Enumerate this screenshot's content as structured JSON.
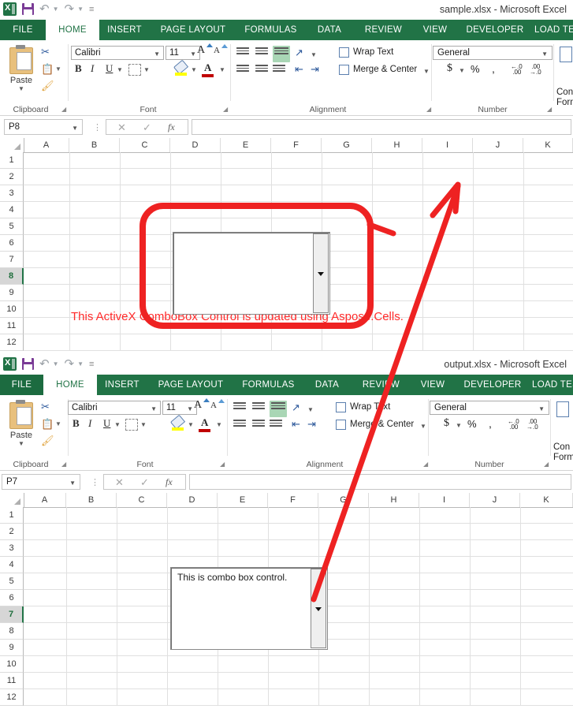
{
  "windows": [
    {
      "id": "sample",
      "title": "sample.xlsx - Microsoft Excel",
      "qat": {
        "logo": "excel-logo",
        "save": "save-icon",
        "undo": "undo-icon",
        "redo": "redo-icon",
        "more": "customize-qat-icon"
      },
      "tabs": [
        {
          "label": "FILE",
          "state": "file"
        },
        {
          "label": "HOME",
          "state": "active"
        },
        {
          "label": "INSERT",
          "state": "normal"
        },
        {
          "label": "PAGE LAYOUT",
          "state": "normal"
        },
        {
          "label": "FORMULAS",
          "state": "normal"
        },
        {
          "label": "DATA",
          "state": "normal"
        },
        {
          "label": "REVIEW",
          "state": "normal"
        },
        {
          "label": "VIEW",
          "state": "normal"
        },
        {
          "label": "DEVELOPER",
          "state": "normal"
        },
        {
          "label": "LOAD TE",
          "state": "normal"
        }
      ],
      "ribbon": {
        "groups": [
          "Clipboard",
          "Font",
          "Alignment",
          "Number"
        ],
        "paste_label": "Paste",
        "font_name": "Calibri",
        "font_size": "11",
        "wrap_text": "Wrap Text",
        "merge_center": "Merge & Center",
        "number_format": "General",
        "conditional_formatting": "Con\nForm"
      },
      "formula_bar": {
        "name_box": "P8",
        "formula": ""
      },
      "grid": {
        "columns": [
          "A",
          "B",
          "C",
          "D",
          "E",
          "F",
          "G",
          "H",
          "I",
          "J",
          "K"
        ],
        "rows": [
          "1",
          "2",
          "3",
          "4",
          "5",
          "6",
          "7",
          "8",
          "9",
          "10",
          "11",
          "12"
        ],
        "selected_row": "8",
        "note_text": "This ActiveX ComboBox Control is updated using Aspose.Cells.",
        "note_color": "#ff2a2a",
        "combobox_value": ""
      }
    },
    {
      "id": "output",
      "title": "output.xlsx - Microsoft Excel",
      "qat": {
        "logo": "excel-logo",
        "save": "save-icon",
        "undo": "undo-icon",
        "redo": "redo-icon",
        "more": "customize-qat-icon"
      },
      "tabs": [
        {
          "label": "FILE",
          "state": "file"
        },
        {
          "label": "HOME",
          "state": "active"
        },
        {
          "label": "INSERT",
          "state": "normal"
        },
        {
          "label": "PAGE LAYOUT",
          "state": "normal"
        },
        {
          "label": "FORMULAS",
          "state": "normal"
        },
        {
          "label": "DATA",
          "state": "normal"
        },
        {
          "label": "REVIEW",
          "state": "normal"
        },
        {
          "label": "VIEW",
          "state": "normal"
        },
        {
          "label": "DEVELOPER",
          "state": "normal"
        },
        {
          "label": "LOAD TES",
          "state": "normal"
        }
      ],
      "ribbon": {
        "groups": [
          "Clipboard",
          "Font",
          "Alignment",
          "Number"
        ],
        "paste_label": "Paste",
        "font_name": "Calibri",
        "font_size": "11",
        "wrap_text": "Wrap Text",
        "merge_center": "Merge & Center",
        "number_format": "General",
        "conditional_formatting": "Con\nForm"
      },
      "formula_bar": {
        "name_box": "P7",
        "formula": ""
      },
      "grid": {
        "columns": [
          "A",
          "B",
          "C",
          "D",
          "E",
          "F",
          "G",
          "H",
          "I",
          "J",
          "K"
        ],
        "rows": [
          "1",
          "2",
          "3",
          "4",
          "5",
          "6",
          "7",
          "8",
          "9",
          "10",
          "11",
          "12"
        ],
        "selected_row": "7",
        "note_text": "",
        "combobox_value": "This is combo box control."
      }
    }
  ],
  "annotations": {
    "highlight_color": "#ee2222",
    "callout_shape": "rounded-rectangle",
    "arrow_shape": "long-arrow"
  }
}
